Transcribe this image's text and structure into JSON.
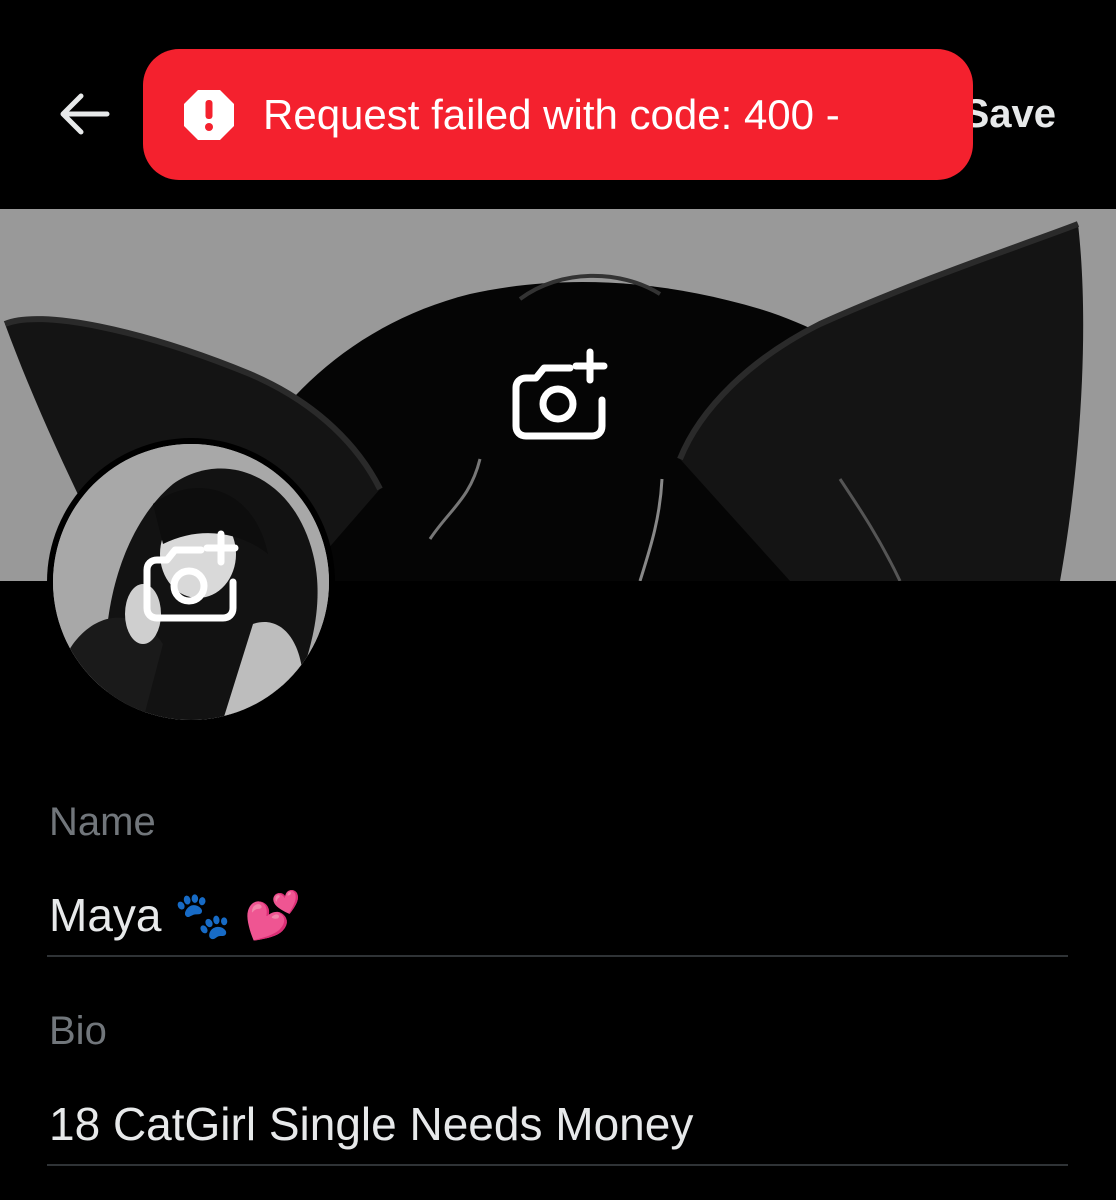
{
  "header": {
    "save_label": "Save",
    "back_icon": "arrow-left-icon"
  },
  "toast": {
    "message": "Request failed with code: 400 -",
    "icon": "alert-octagon-icon",
    "color": "#f4212e"
  },
  "banner": {
    "icon": "camera-plus-icon"
  },
  "avatar": {
    "icon": "camera-plus-icon"
  },
  "form": {
    "name_label": "Name",
    "name_value": "Maya 🐾 💕",
    "bio_label": "Bio",
    "bio_value": "18 CatGirl Single Needs Money"
  },
  "colors": {
    "background": "#000000",
    "label": "#71767b",
    "text": "#e7e9ea",
    "divider": "#2f3336"
  }
}
